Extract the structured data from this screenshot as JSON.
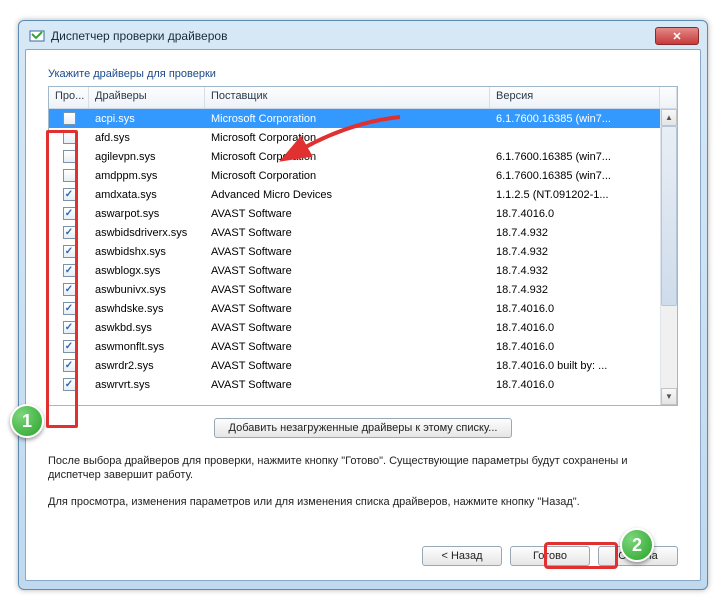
{
  "window": {
    "title": "Диспетчер проверки драйверов",
    "close_glyph": "✕"
  },
  "group_label": "Укажите драйверы для проверки",
  "columns": {
    "check": "Про...",
    "driver": "Драйверы",
    "vendor": "Поставщик",
    "version": "Версия"
  },
  "rows": [
    {
      "checked": false,
      "selected": true,
      "driver": "acpi.sys",
      "vendor": "Microsoft Corporation",
      "version": "6.1.7600.16385 (win7..."
    },
    {
      "checked": false,
      "selected": false,
      "driver": "afd.sys",
      "vendor": "Microsoft Corporation",
      "version": ""
    },
    {
      "checked": false,
      "selected": false,
      "driver": "agilevpn.sys",
      "vendor": "Microsoft Corporation",
      "version": "6.1.7600.16385 (win7..."
    },
    {
      "checked": false,
      "selected": false,
      "driver": "amdppm.sys",
      "vendor": "Microsoft Corporation",
      "version": "6.1.7600.16385 (win7..."
    },
    {
      "checked": true,
      "selected": false,
      "driver": "amdxata.sys",
      "vendor": "Advanced Micro Devices",
      "version": "1.1.2.5 (NT.091202-1..."
    },
    {
      "checked": true,
      "selected": false,
      "driver": "aswarpot.sys",
      "vendor": "AVAST Software",
      "version": "18.7.4016.0"
    },
    {
      "checked": true,
      "selected": false,
      "driver": "aswbidsdriverx.sys",
      "vendor": "AVAST Software",
      "version": "18.7.4.932"
    },
    {
      "checked": true,
      "selected": false,
      "driver": "aswbidshx.sys",
      "vendor": "AVAST Software",
      "version": "18.7.4.932"
    },
    {
      "checked": true,
      "selected": false,
      "driver": "aswblogx.sys",
      "vendor": "AVAST Software",
      "version": "18.7.4.932"
    },
    {
      "checked": true,
      "selected": false,
      "driver": "aswbunivx.sys",
      "vendor": "AVAST Software",
      "version": "18.7.4.932"
    },
    {
      "checked": true,
      "selected": false,
      "driver": "aswhdske.sys",
      "vendor": "AVAST Software",
      "version": "18.7.4016.0"
    },
    {
      "checked": true,
      "selected": false,
      "driver": "aswkbd.sys",
      "vendor": "AVAST Software",
      "version": "18.7.4016.0"
    },
    {
      "checked": true,
      "selected": false,
      "driver": "aswmonflt.sys",
      "vendor": "AVAST Software",
      "version": "18.7.4016.0"
    },
    {
      "checked": true,
      "selected": false,
      "driver": "aswrdr2.sys",
      "vendor": "AVAST Software",
      "version": "18.7.4016.0 built by: ..."
    },
    {
      "checked": true,
      "selected": false,
      "driver": "aswrvrt.sys",
      "vendor": "AVAST Software",
      "version": "18.7.4016.0"
    }
  ],
  "buttons": {
    "add_unloaded": "Добавить незагруженные драйверы к этому списку...",
    "back": "< Назад",
    "finish": "Готово",
    "cancel": "Отмена"
  },
  "info": {
    "line1": "После выбора драйверов для проверки, нажмите кнопку \"Готово\". Существующие параметры будут сохранены и диспетчер завершит работу.",
    "line2": "Для просмотра, изменения параметров или для изменения списка драйверов, нажмите кнопку \"Назад\"."
  },
  "annotations": {
    "badge1": "1",
    "badge2": "2"
  }
}
